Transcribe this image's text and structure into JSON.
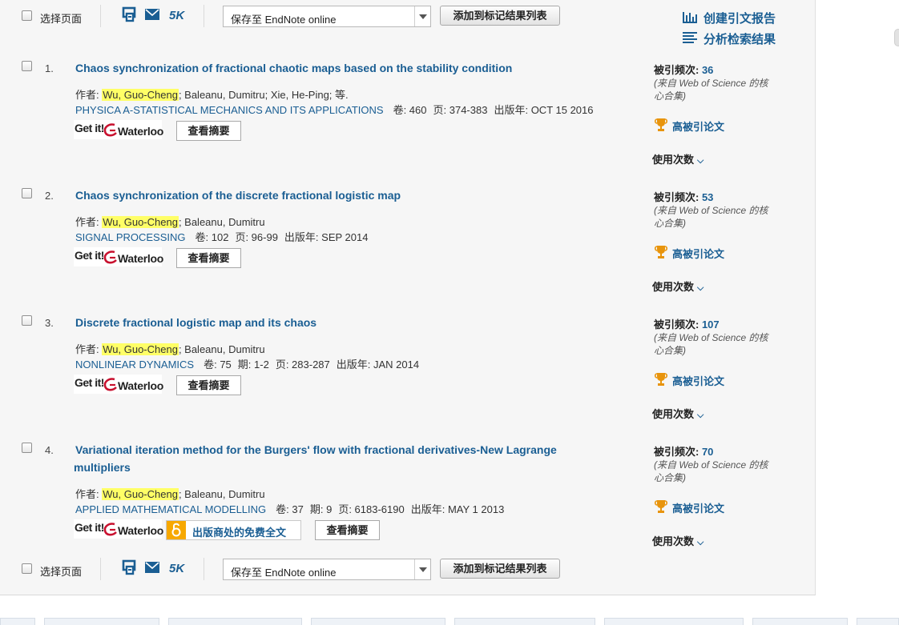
{
  "toolbar": {
    "select_page_label": "选择页面",
    "five_k_label": "5K",
    "save_to_value": "保存至 EndNote online",
    "add_to_marked_label": "添加到标记结果列表"
  },
  "side_links": {
    "citation_report": "创建引文报告",
    "analyze_results": "分析检索结果"
  },
  "labels": {
    "authors_prefix": "作者: ",
    "volume": "卷: ",
    "issue": "期: ",
    "pages": "页: ",
    "published": "出版年: ",
    "view_abstract": "查看摘要",
    "times_cited": "被引频次: ",
    "cited_source": "(来自 Web of Science 的核心合集)",
    "highly_cited": "高被引论文",
    "usage_count": "使用次数",
    "free_full_text": "出版商处的免费全文",
    "get_it": "Get it!",
    "waterloo": "Waterloo"
  },
  "records": [
    {
      "num": "1.",
      "title": "Chaos synchronization of fractional chaotic maps based on the stability condition",
      "highlighted_author": "Wu, Guo-Cheng",
      "other_authors": "; Baleanu, Dumitru; Xie, He-Ping; 等.",
      "journal": "PHYSICA A-STATISTICAL MECHANICS AND ITS APPLICATIONS",
      "volume": "460",
      "issue": "",
      "pages": "374-383",
      "published": "OCT 15 2016",
      "times_cited": "36"
    },
    {
      "num": "2.",
      "title": "Chaos synchronization of the discrete fractional logistic map",
      "highlighted_author": "Wu, Guo-Cheng",
      "other_authors": "; Baleanu, Dumitru",
      "journal": "SIGNAL PROCESSING",
      "volume": "102",
      "issue": "",
      "pages": "96-99",
      "published": "SEP 2014",
      "times_cited": "53"
    },
    {
      "num": "3.",
      "title": "Discrete fractional logistic map and its chaos",
      "highlighted_author": "Wu, Guo-Cheng",
      "other_authors": "; Baleanu, Dumitru",
      "journal": "NONLINEAR DYNAMICS",
      "volume": "75",
      "issue": "1-2",
      "pages": "283-287",
      "published": "JAN 2014",
      "times_cited": "107"
    },
    {
      "num": "4.",
      "title": "Variational iteration method for the Burgers' flow with fractional derivatives-New Lagrange multipliers",
      "highlighted_author": "Wu, Guo-Cheng",
      "other_authors": "; Baleanu, Dumitru",
      "journal": "APPLIED MATHEMATICAL MODELLING",
      "volume": "37",
      "issue": "9",
      "pages": "6183-6190",
      "published": "MAY 1 2013",
      "times_cited": "70"
    }
  ],
  "colors": {
    "link_blue": "#1a5e93",
    "highlight_yellow": "#ffff66",
    "panel_bg": "#f6f6f6",
    "trophy_orange": "#e8940c",
    "waterloo_red": "#c8102e",
    "oa_orange": "#f7a800"
  },
  "icons": [
    "print-icon",
    "email-icon",
    "bar-chart-icon",
    "list-icon",
    "trophy-icon",
    "chevron-down-icon",
    "open-access-icon",
    "waterloo-logo"
  ]
}
